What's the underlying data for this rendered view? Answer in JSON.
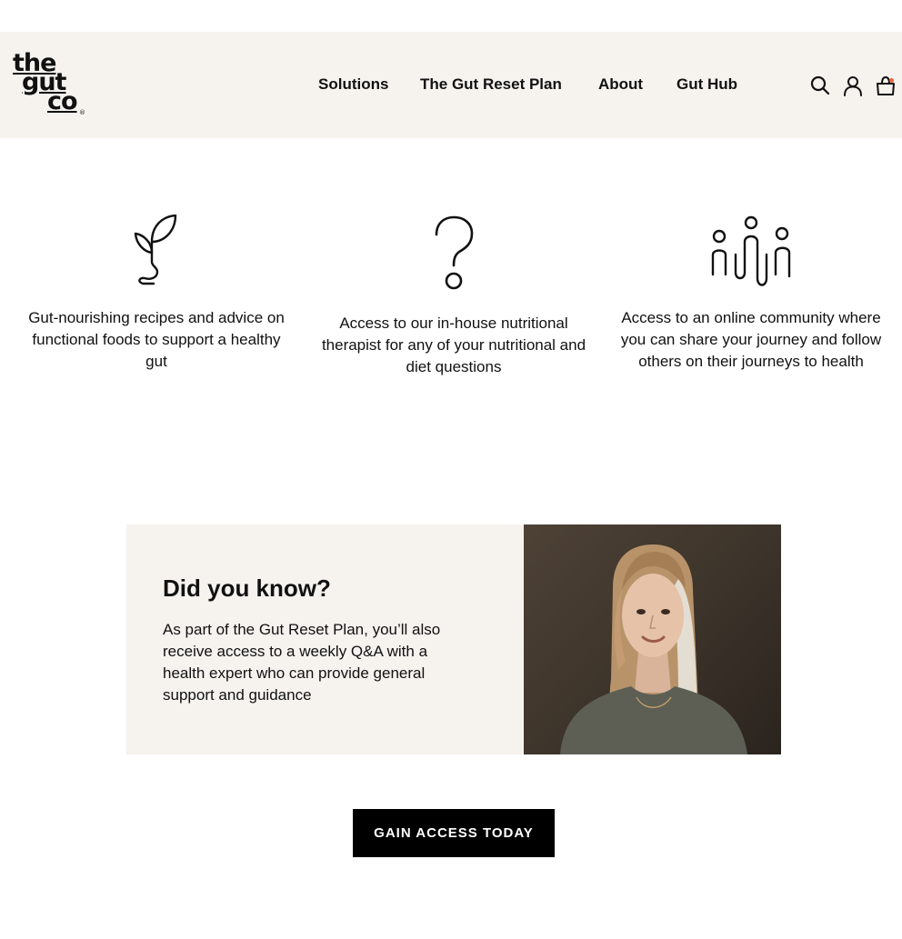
{
  "brand": {
    "logo_line1": "the",
    "logo_line2": "gut",
    "logo_line3": "co",
    "logo_reg": "®"
  },
  "nav": {
    "items": [
      {
        "label": "Solutions"
      },
      {
        "label": "The Gut Reset Plan"
      },
      {
        "label": "About"
      },
      {
        "label": "Gut Hub"
      }
    ],
    "active": "The Gut Reset Plan"
  },
  "header_icons": [
    "search-icon",
    "account-icon",
    "cart-icon"
  ],
  "features": [
    {
      "icon": "sprout-icon",
      "text": "Gut-nourishing recipes and advice on functional foods to support a healthy gut"
    },
    {
      "icon": "question-mark-icon",
      "text": "Access to our in-house nutritional therapist for any of your nutritional and diet questions"
    },
    {
      "icon": "community-icon",
      "text": "Access to an online community where you can share your journey and follow others on their journeys to health"
    }
  ],
  "did_you_know": {
    "title": "Did you know?",
    "body": "As part of the Gut Reset Plan, you’ll also receive access to a weekly Q&A with a health expert who can provide general support and guidance"
  },
  "cta": {
    "label": "GAIN ACCESS TODAY"
  },
  "colors": {
    "header_bg": "#f6f3ef",
    "panel_bg": "#f6f3ef",
    "button_bg": "#000000",
    "button_text": "#ffffff",
    "cart_badge": "#e8643c",
    "text": "#111111"
  }
}
